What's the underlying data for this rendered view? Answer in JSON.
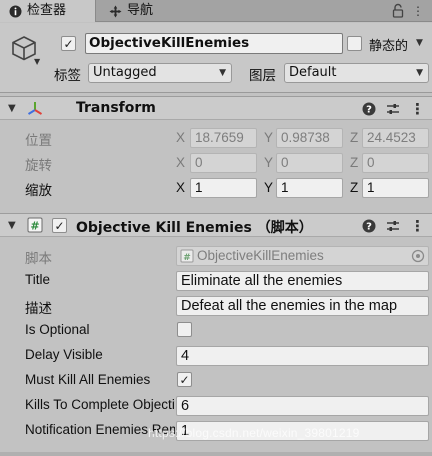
{
  "tabs": {
    "inspector": "检查器",
    "navigation": "导航"
  },
  "header": {
    "active_checked": "✓",
    "object_name": "ObjectiveKillEnemies",
    "static_label": "静态的",
    "tag_label": "标签",
    "tag_value": "Untagged",
    "layer_label": "图层",
    "layer_value": "Default"
  },
  "transform": {
    "title": "Transform",
    "position_label": "位置",
    "rotation_label": "旋转",
    "scale_label": "缩放",
    "axes": [
      "X",
      "Y",
      "Z"
    ],
    "position": [
      "18.7659",
      "0.98738",
      "24.4523"
    ],
    "rotation": [
      "0",
      "0",
      "0"
    ],
    "scale": [
      "1",
      "1",
      "1"
    ]
  },
  "component": {
    "enabled_check": "✓",
    "title": "Objective Kill Enemies （脚本）",
    "script_label": "脚本",
    "script_value": "ObjectiveKillEnemies",
    "fields": [
      {
        "label": "Title",
        "value": "Eliminate all the enemies"
      },
      {
        "label": "描述",
        "value": "Defeat all the enemies in the map"
      },
      {
        "label": "Is Optional",
        "value": ""
      },
      {
        "label": "Delay Visible",
        "value": "4"
      },
      {
        "label": "Must Kill All Enemies",
        "value": "✓"
      },
      {
        "label": "Kills To Complete Objective",
        "value": "6"
      },
      {
        "label": "Notification Enemies Remaining Threshold",
        "value": "1"
      }
    ]
  },
  "watermark": "https://blog.csdn.net/weixin_39801219",
  "colors": {
    "panel": "#c2c2c2",
    "header": "#cbcbcb",
    "field": "#f0f0f0",
    "transform_icon_red": "#e0413a",
    "transform_icon_green": "#5aa52d",
    "transform_icon_blue": "#3f6fe0"
  },
  "icons": {
    "inspector_tab": "info-icon",
    "navigation_tab": "navigation-icon",
    "lock": "lock-icon",
    "menu": "menu-icon",
    "gameobject": "cube-icon",
    "transform": "transform-axes-icon",
    "script": "csharp-script-icon",
    "help": "help-icon",
    "presets": "presets-icon",
    "context": "context-menu-icon",
    "object_picker": "object-picker-icon"
  }
}
